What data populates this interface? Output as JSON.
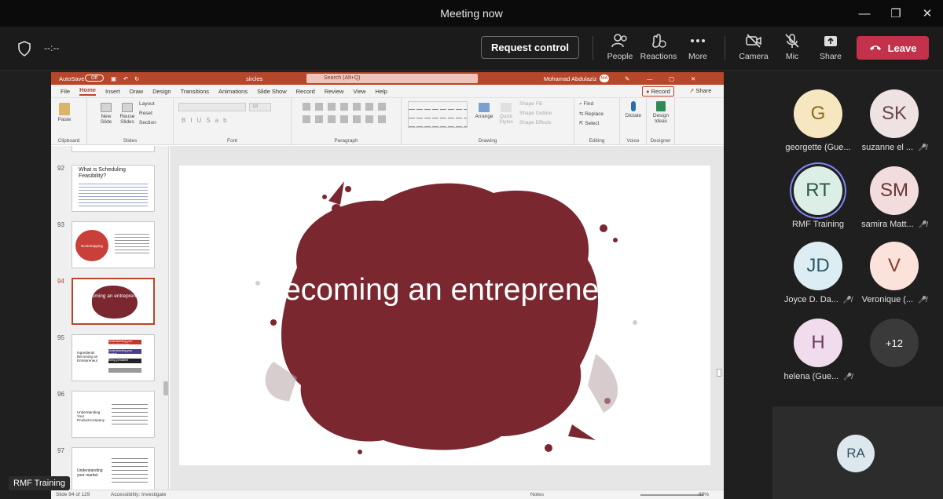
{
  "window": {
    "title": "Meeting now"
  },
  "toolbar": {
    "timer": "--:--",
    "request_control": "Request control",
    "people": "People",
    "reactions": "Reactions",
    "more": "More",
    "camera": "Camera",
    "mic": "Mic",
    "share": "Share",
    "leave": "Leave"
  },
  "ppt": {
    "autosave": "AutoSave",
    "autosave_state": "Off",
    "filename": "sircles",
    "search_placeholder": "Search (Alt+Q)",
    "user": "Mohamad Abdulaziz",
    "user_initials": "MA",
    "menu": [
      "File",
      "Home",
      "Insert",
      "Draw",
      "Design",
      "Transitions",
      "Animations",
      "Slide Show",
      "Record",
      "Review",
      "View",
      "Help"
    ],
    "record": "Record",
    "share": "Share",
    "ribbon": {
      "clipboard": "Clipboard",
      "slides": "Slides",
      "font": "Font",
      "paragraph": "Paragraph",
      "drawing": "Drawing",
      "editing": "Editing",
      "voice": "Voice",
      "designer": "Designer",
      "paste": "Paste",
      "new_slide": "New Slide",
      "reuse_slides": "Reuse Slides",
      "layout": "Layout",
      "reset": "Reset",
      "section": "Section",
      "font_size": "18",
      "arrange": "Arrange",
      "quick_styles": "Quick Styles",
      "shape_fill": "Shape Fill",
      "shape_outline": "Shape Outline",
      "shape_effects": "Shape Effects",
      "find": "Find",
      "replace": "Replace",
      "select": "Select",
      "dictate": "Dictate",
      "design_ideas": "Design Ideas"
    },
    "thumbs": [
      {
        "num": "92",
        "title": "What is Scheduling Feasibility?"
      },
      {
        "num": "93",
        "title": "Bootstrapping"
      },
      {
        "num": "94",
        "title": "Becoming an entrepreneur"
      },
      {
        "num": "95",
        "title": "Ingredients Becoming an Entrepreneur",
        "items": [
          "Understanding your product/company",
          "Understanding your market",
          "Being persistent"
        ]
      },
      {
        "num": "96",
        "title": "Understanding Your Product/company"
      },
      {
        "num": "97",
        "title": "Understanding your market"
      }
    ],
    "slide_title": "Becoming an entrepreneur",
    "status": {
      "slide": "Slide 94 of 129",
      "accessibility": "Accessibility: Investigate",
      "notes": "Notes",
      "zoom": "89%"
    }
  },
  "presenter_label": "RMF Training",
  "participants": [
    {
      "initials": "G",
      "name": "georgette (Gue...",
      "muted": false,
      "bg": "#f6e7c1",
      "fg": "#8a6a1e"
    },
    {
      "initials": "SK",
      "name": "suzanne el ...",
      "muted": true,
      "bg": "#efe2e2",
      "fg": "#6a4545"
    },
    {
      "initials": "RT",
      "name": "RMF Training",
      "muted": false,
      "bg": "#dcefe6",
      "fg": "#2d5a45",
      "speaking": true
    },
    {
      "initials": "SM",
      "name": "samira Matt...",
      "muted": true,
      "bg": "#f3dcdc",
      "fg": "#6a3535"
    },
    {
      "initials": "JD",
      "name": "Joyce D. Da...",
      "muted": true,
      "bg": "#dceef3",
      "fg": "#2e5a6a"
    },
    {
      "initials": "V",
      "name": "Veronique (...",
      "muted": true,
      "bg": "#fbe3dc",
      "fg": "#8a3d2d"
    },
    {
      "initials": "H",
      "name": "helena (Gue...",
      "muted": true,
      "bg": "#f0dcec",
      "fg": "#6a3d62"
    },
    {
      "initials": "+12",
      "name": "",
      "muted": false,
      "bg": "#3a3a3a",
      "fg": "#ffffff"
    }
  ],
  "self_tile": {
    "initials": "RA"
  },
  "colors": {
    "accent": "#b7472a",
    "leave": "#c4314b",
    "blob": "#7a2730"
  }
}
